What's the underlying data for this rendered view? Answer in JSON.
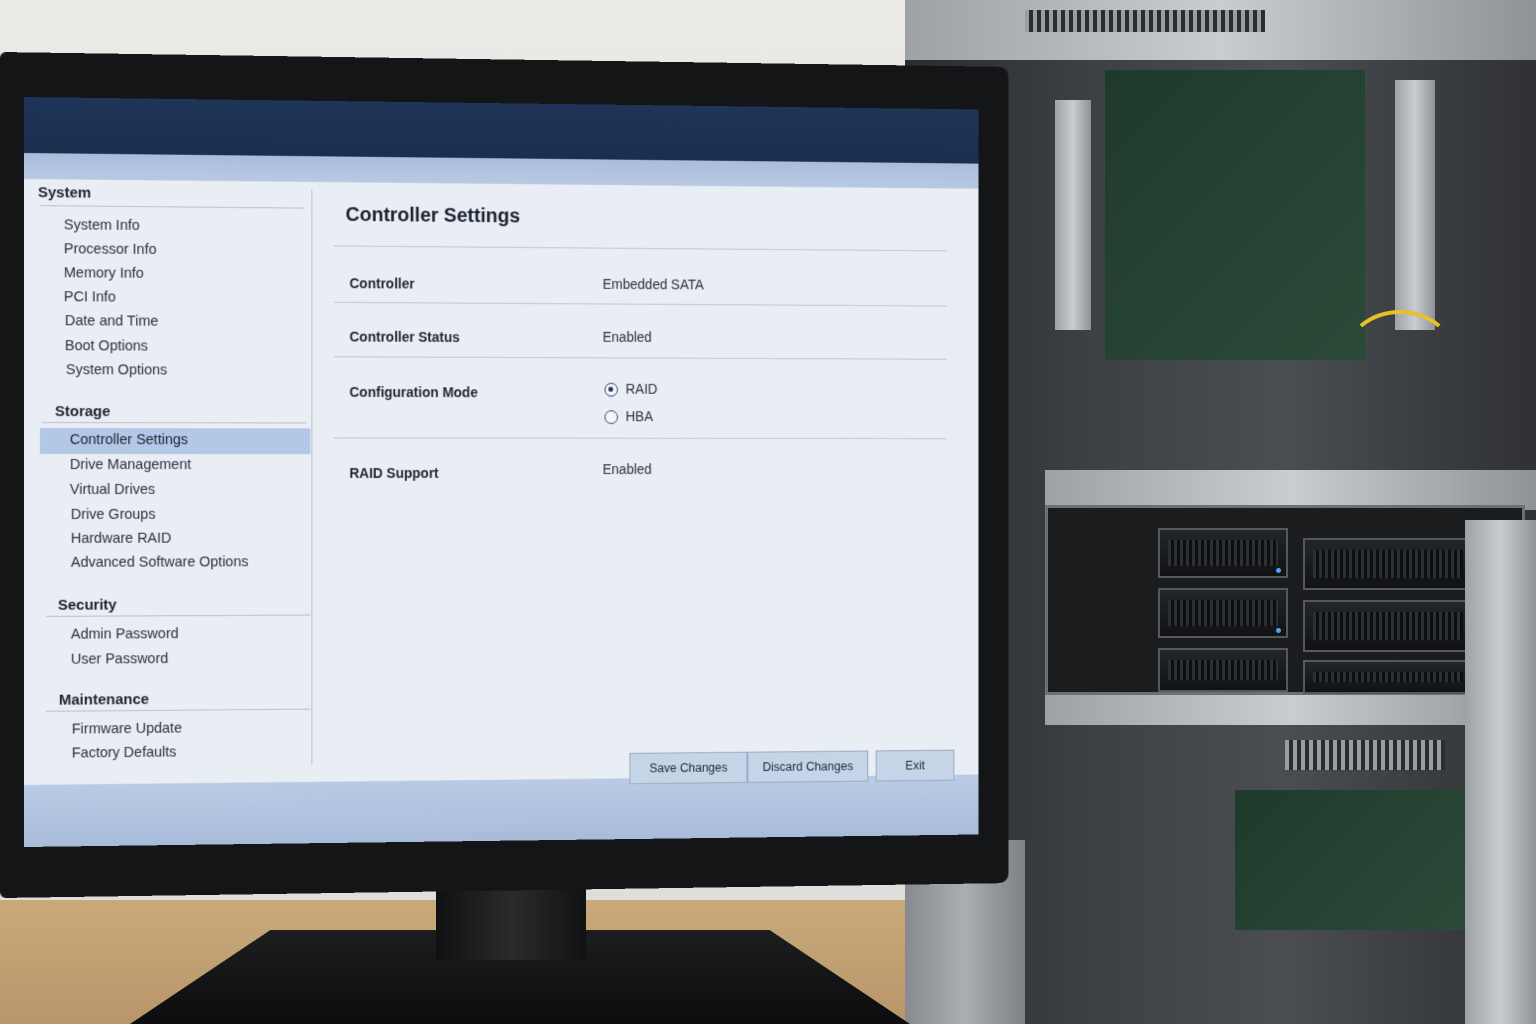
{
  "sidebar": {
    "groups": [
      {
        "title": "System",
        "items": [
          "System Info",
          "Processor Info",
          "Memory Info",
          "PCI Info",
          "Date and Time",
          "Boot Options",
          "System Options"
        ]
      },
      {
        "title": "Storage",
        "items": [
          "Controller Settings",
          "Drive Management",
          "Virtual Drives",
          "Drive Groups",
          "Hardware RAID",
          "Advanced Software Options"
        ]
      },
      {
        "title": "Security",
        "items": [
          "Admin Password",
          "User Password"
        ]
      },
      {
        "title": "Maintenance",
        "items": [
          "Firmware Update",
          "Factory Defaults"
        ]
      }
    ],
    "active_item": "Controller Settings"
  },
  "main": {
    "title": "Controller Settings",
    "fields": [
      {
        "label": "Controller",
        "value": "Embedded SATA"
      },
      {
        "label": "Controller Status",
        "value": "Enabled"
      },
      {
        "label": "Configuration Mode",
        "options": [
          "RAID",
          "HBA"
        ],
        "selected": "RAID"
      },
      {
        "label": "RAID Support",
        "value": "Enabled"
      }
    ]
  },
  "footer": {
    "save_label": "Save Changes",
    "discard_label": "Discard Changes",
    "exit_label": "Exit"
  },
  "colors": {
    "titlebar": "#1f3558",
    "accent": "#b3c8e6",
    "panel": "#e9edf4"
  }
}
